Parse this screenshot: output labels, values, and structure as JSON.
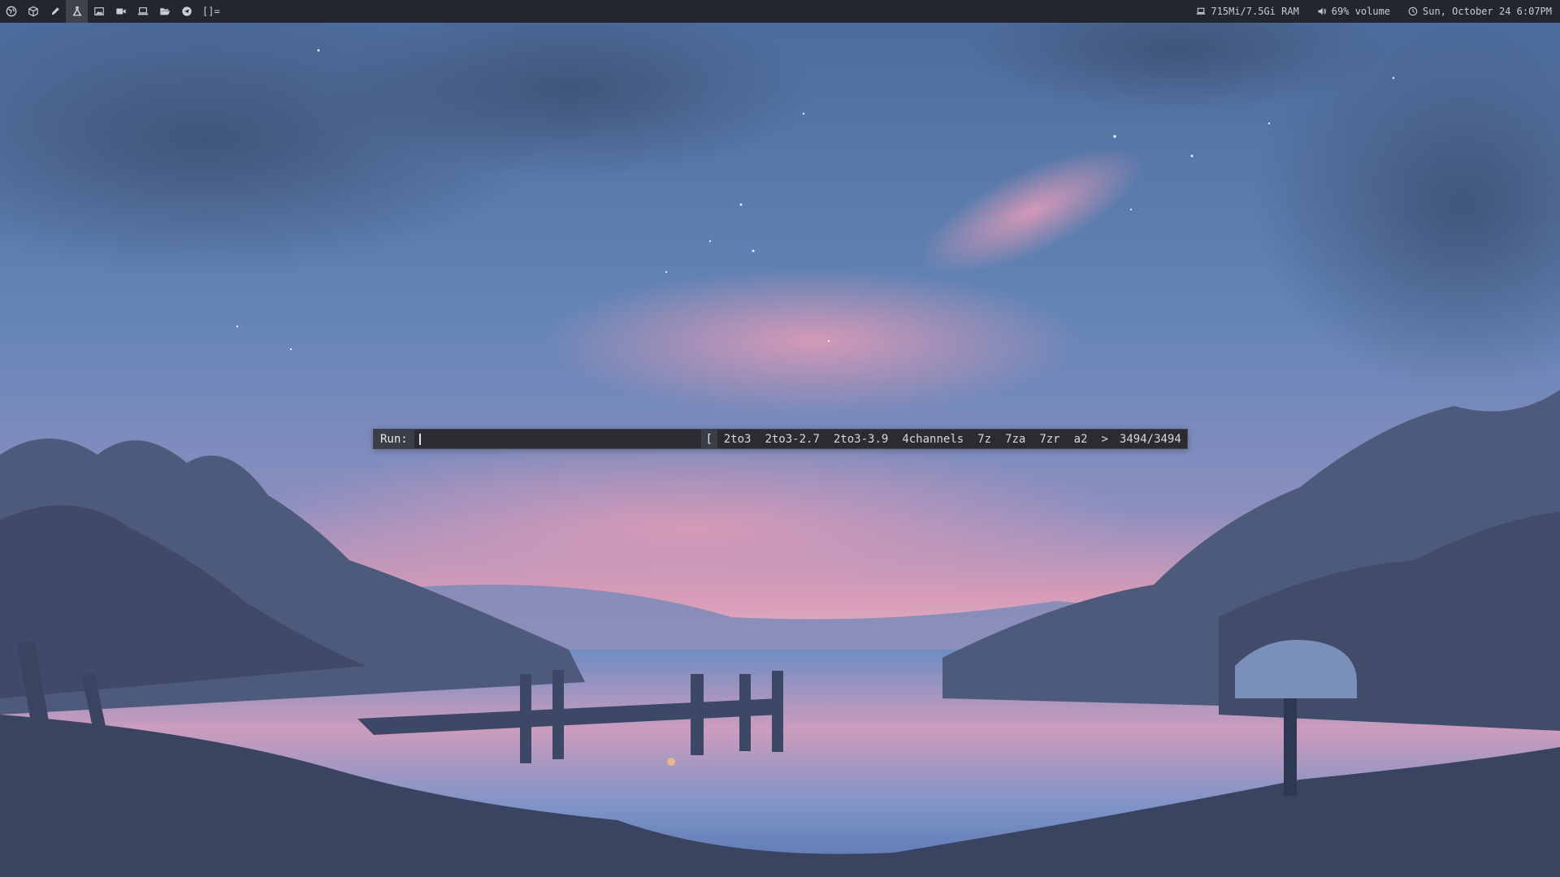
{
  "topbar": {
    "workspaces": [
      {
        "icon": "globe-icon",
        "active": false
      },
      {
        "icon": "cube-icon",
        "active": false
      },
      {
        "icon": "pen-icon",
        "active": false
      },
      {
        "icon": "flask-icon",
        "active": true
      },
      {
        "icon": "image-icon",
        "active": false
      },
      {
        "icon": "video-camera-icon",
        "active": false
      },
      {
        "icon": "laptop-icon",
        "active": false
      },
      {
        "icon": "folder-open-icon",
        "active": false
      },
      {
        "icon": "send-icon",
        "active": false
      }
    ],
    "layout_symbol": "[]=",
    "status": {
      "ram_icon": "laptop-icon",
      "ram": "715Mi/7.5Gi RAM",
      "volume_icon": "speaker-icon",
      "volume": "69% volume",
      "clock_icon": "clock-icon",
      "datetime": "Sun, October 24 6:07PM"
    },
    "colors": {
      "bar_bg": "#23262e",
      "active_ws_bg": "#3f434d",
      "text": "#c9ccd3"
    }
  },
  "run_prompt": {
    "label": "Run:",
    "input_value": "",
    "bracket": "[",
    "completions": [
      "2to3",
      "2to3-2.7",
      "2to3-3.9",
      "4channels",
      "7z",
      "7za",
      "7zr",
      "a2"
    ],
    "more_indicator": ">",
    "match_count": "3494/3494"
  },
  "wallpaper": {
    "description_colors": {
      "sky_top": "#4c6c9c",
      "sky_mid": "#6f8fc0",
      "pink_glow": "#d49ab3",
      "trees": "#4b5878",
      "water": "#7290c6"
    }
  }
}
